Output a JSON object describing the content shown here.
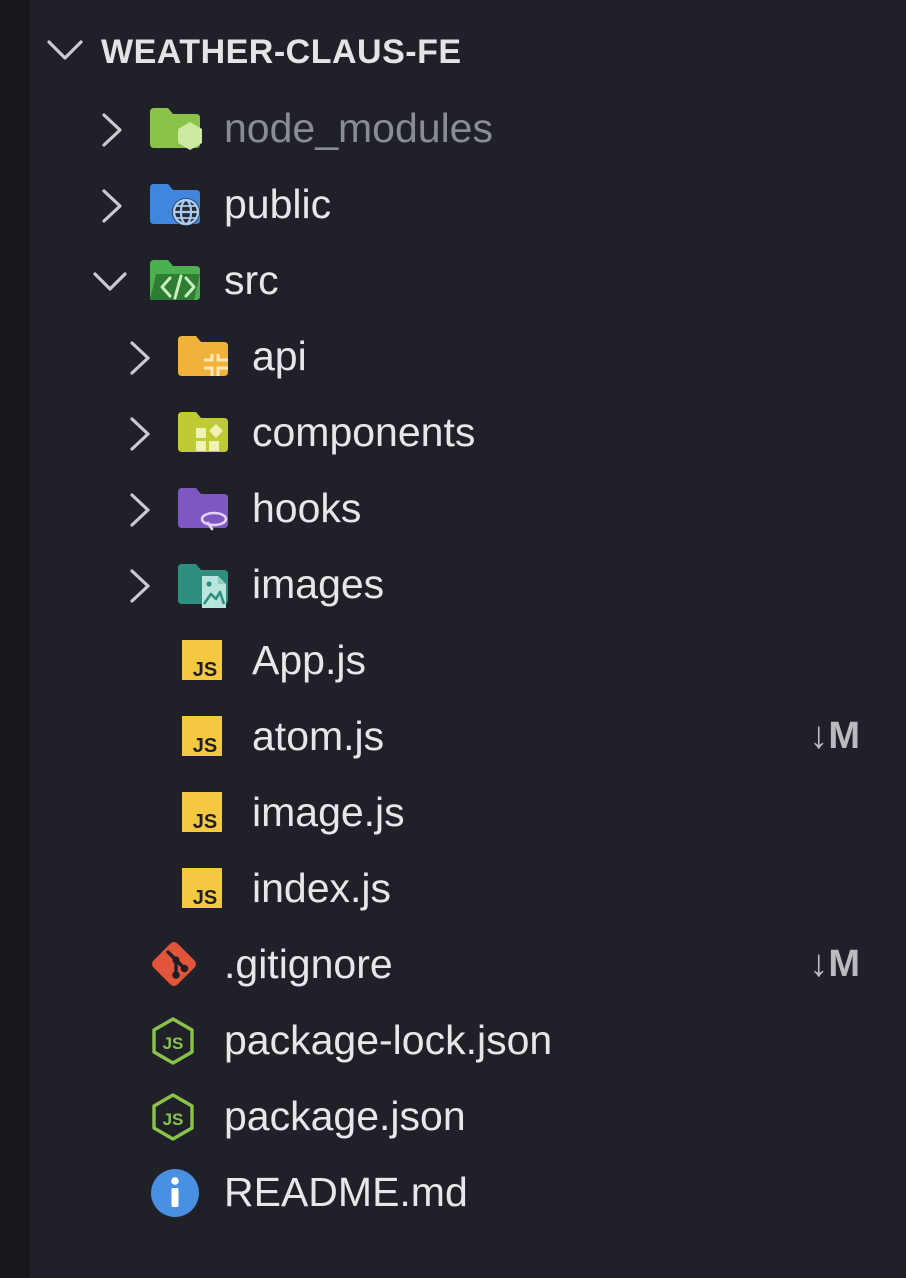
{
  "explorer": {
    "root_title": "WEATHER-CLAUS-FE",
    "items": [
      {
        "label": "node_modules",
        "kind": "folder",
        "icon": "node-folder-icon",
        "expanded": false,
        "dim": true,
        "badge": ""
      },
      {
        "label": "public",
        "kind": "folder",
        "icon": "globe-folder-icon",
        "expanded": false,
        "badge": ""
      },
      {
        "label": "src",
        "kind": "folder",
        "icon": "code-folder-icon",
        "expanded": true,
        "badge": ""
      },
      {
        "label": "api",
        "kind": "folder",
        "icon": "api-folder-icon",
        "expanded": false,
        "badge": ""
      },
      {
        "label": "components",
        "kind": "folder",
        "icon": "components-folder-icon",
        "expanded": false,
        "badge": ""
      },
      {
        "label": "hooks",
        "kind": "folder",
        "icon": "hooks-folder-icon",
        "expanded": false,
        "badge": ""
      },
      {
        "label": "images",
        "kind": "folder",
        "icon": "images-folder-icon",
        "expanded": false,
        "badge": ""
      },
      {
        "label": "App.js",
        "kind": "file",
        "icon": "javascript-file-icon",
        "badge": ""
      },
      {
        "label": "atom.js",
        "kind": "file",
        "icon": "javascript-file-icon",
        "badge": "↓M"
      },
      {
        "label": "image.js",
        "kind": "file",
        "icon": "javascript-file-icon",
        "badge": ""
      },
      {
        "label": "index.js",
        "kind": "file",
        "icon": "javascript-file-icon",
        "badge": ""
      },
      {
        "label": ".gitignore",
        "kind": "file",
        "icon": "git-file-icon",
        "badge": "↓M"
      },
      {
        "label": "package-lock.json",
        "kind": "file",
        "icon": "nodejs-file-icon",
        "badge": ""
      },
      {
        "label": "package.json",
        "kind": "file",
        "icon": "nodejs-file-icon",
        "badge": ""
      },
      {
        "label": "README.md",
        "kind": "file",
        "icon": "info-file-icon",
        "badge": ""
      }
    ]
  },
  "colors": {
    "background": "#202128",
    "text": "#e6e7ea",
    "dim_text": "#8a8c93",
    "badge": "#b9bbc1",
    "js_yellow": "#f5c842",
    "node_green": "#8bc34a",
    "git_orange": "#e2553a",
    "info_blue": "#4a90e2"
  }
}
